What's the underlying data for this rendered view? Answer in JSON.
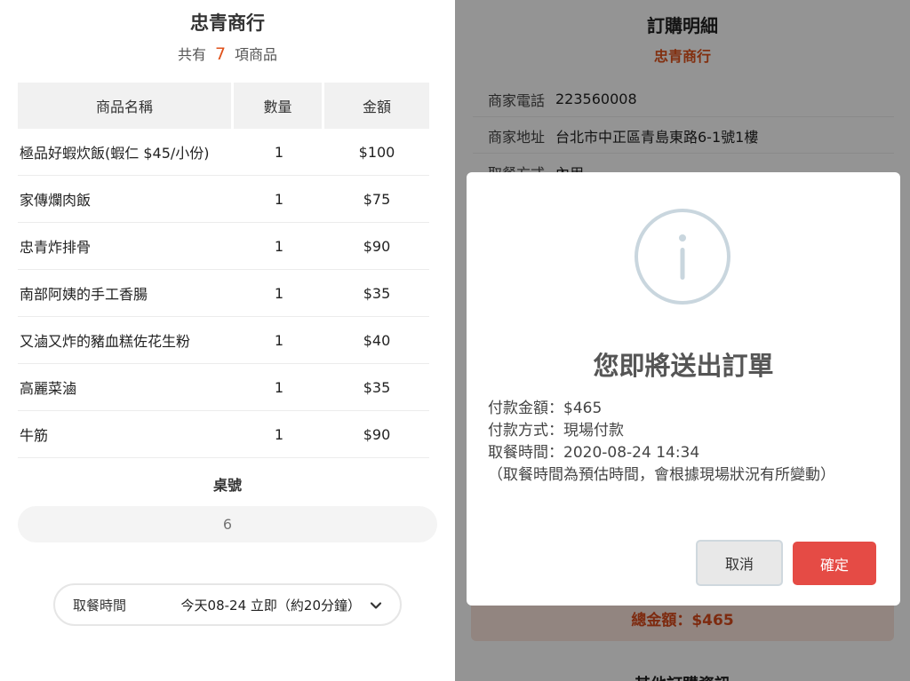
{
  "left": {
    "store_name": "忠青商行",
    "count_prefix": "共有",
    "count_value": "7",
    "count_suffix": "項商品",
    "columns": [
      "商品名稱",
      "數量",
      "金額"
    ],
    "items": [
      {
        "name": "極品好蝦炊飯(蝦仁 $45/小份)",
        "qty": "1",
        "amount": "$100"
      },
      {
        "name": "家傳爛肉飯",
        "qty": "1",
        "amount": "$75"
      },
      {
        "name": "忠青炸排骨",
        "qty": "1",
        "amount": "$90"
      },
      {
        "name": "南部阿姨的手工香腸",
        "qty": "1",
        "amount": "$35"
      },
      {
        "name": "又滷又炸的豬血糕佐花生粉",
        "qty": "1",
        "amount": "$40"
      },
      {
        "name": "高麗菜滷",
        "qty": "1",
        "amount": "$35"
      },
      {
        "name": "牛筋",
        "qty": "1",
        "amount": "$90"
      }
    ],
    "table_label": "桌號",
    "table_placeholder": "6",
    "pickup_label": "取餐時間",
    "pickup_value": "今天08-24 立即（約20分鐘）"
  },
  "right": {
    "title": "訂購明細",
    "store_name": "忠青商行",
    "info": [
      {
        "key": "商家電話",
        "value": "223560008"
      },
      {
        "key": "商家地址",
        "value": "台北市中正區青島東路6-1號1樓"
      },
      {
        "key": "取餐方式",
        "value": "內用"
      }
    ],
    "total_text": "總金額：$465",
    "more_text": "其他訂購資訊"
  },
  "modal": {
    "title": "您即將送出訂單",
    "lines": [
      "付款金額：$465",
      "付款方式：現場付款",
      "取餐時間：2020-08-24 14:34",
      "（取餐時間為預估時間，會根據現場狀況有所變動）"
    ],
    "cancel_label": "取消",
    "confirm_label": "確定"
  },
  "colors": {
    "accent": "#e0521b",
    "confirm_button": "#e54b45",
    "info_icon": "#c9d6de"
  },
  "icons": {
    "info": "info-circle-icon",
    "chevron": "chevron-down-icon"
  }
}
